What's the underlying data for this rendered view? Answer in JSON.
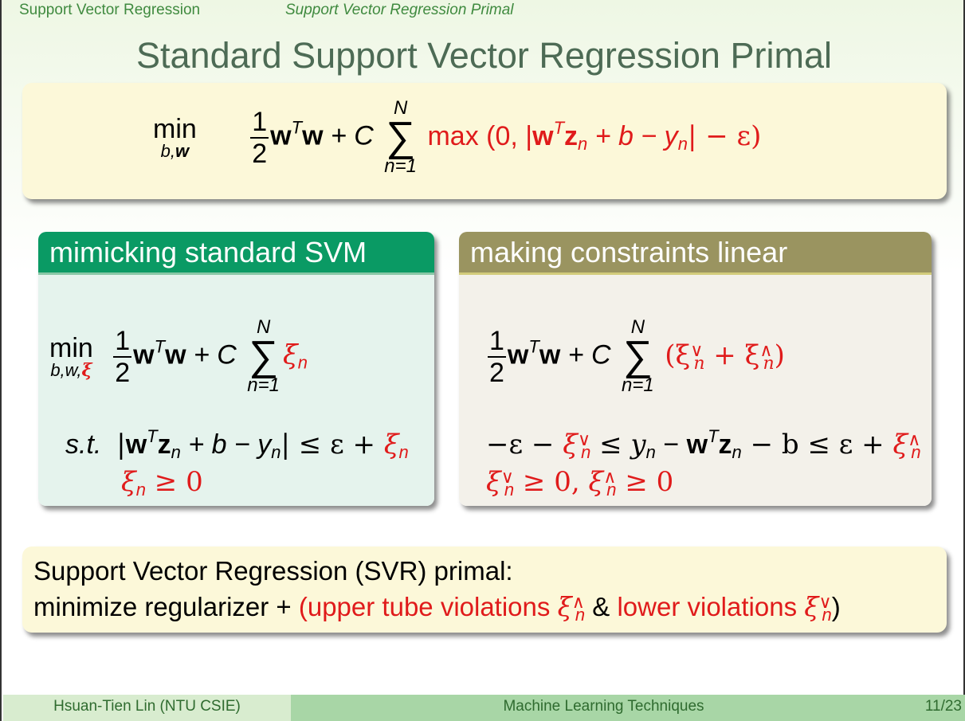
{
  "nav": {
    "section": "Support Vector Regression",
    "subsection": "Support Vector Regression Primal"
  },
  "slide_title": "Standard Support Vector Regression Primal",
  "main_formula": {
    "min": "min",
    "min_sub": "b,",
    "min_sub_bold": "w",
    "half_num": "1",
    "half_den": "2",
    "w": "w",
    "T": "T",
    "plus_C": " + C",
    "sum_top": "N",
    "sum_sign": "∑",
    "sum_bottom": "n=1",
    "max_text": "max",
    "max_body_a": "(0, |",
    "max_w": "w",
    "max_T": "T",
    "max_z": "z",
    "max_n": "n",
    "max_body_b": " + b − y",
    "max_yn": "n",
    "max_body_c": "| − ε)"
  },
  "left_block": {
    "title": "mimicking standard SVM",
    "min_sub": "b,w,",
    "min_sub_xi": "ξ",
    "st": "s.t.",
    "xi": "ξ",
    "n": "n",
    "c1a": "|",
    "c1b": " + b − y",
    "c1c": "| ≤ ε + ",
    "c2": " ≥ 0"
  },
  "right_block": {
    "title": "making constraints linear",
    "obj_a": "(ξ",
    "obj_v": "∨",
    "obj_b": " + ξ",
    "obj_h": "∧",
    "obj_c": ")",
    "c1a": "−ε − ",
    "c1b": " ≤ y",
    "c1c": " − ",
    "c1d": " − b ≤ ε + ",
    "c2a": " ≥ 0, ",
    "c2b": " ≥ 0"
  },
  "summary": {
    "line1": "Support Vector Regression (SVR) primal:",
    "line2_a": "minimize regularizer + ",
    "line2_b": "(upper tube violations ",
    "line2_c": " & ",
    "line2_d": "lower violations ",
    "line2_e": ")"
  },
  "footer": {
    "author": "Hsuan-Tien Lin  (NTU CSIE)",
    "course": "Machine Learning Techniques",
    "page": "11/23"
  },
  "colors": {
    "accent_green": "#0a9a64",
    "accent_olive": "#9a9460",
    "red": "#e01b1b"
  }
}
